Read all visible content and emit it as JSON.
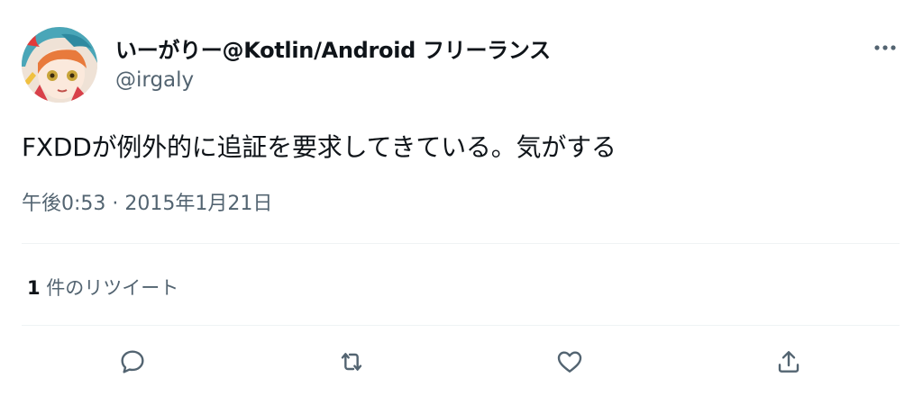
{
  "tweet": {
    "display_name": "いーがりー@Kotlin/Android フリーランス",
    "handle": "@irgaly",
    "text": "FXDDが例外的に追証を要求してきている。気がする",
    "timestamp": "午後0:53 · 2015年1月21日",
    "retweets": {
      "count": "1",
      "label": " 件のリツイート"
    }
  },
  "icons": {
    "more": "more-horizontal-icon",
    "reply": "reply-icon",
    "retweet": "retweet-icon",
    "like": "heart-icon",
    "share": "share-icon"
  },
  "colors": {
    "text_primary": "#0f1419",
    "text_secondary": "#536471",
    "divider": "#eff3f4",
    "icon": "#536471"
  }
}
